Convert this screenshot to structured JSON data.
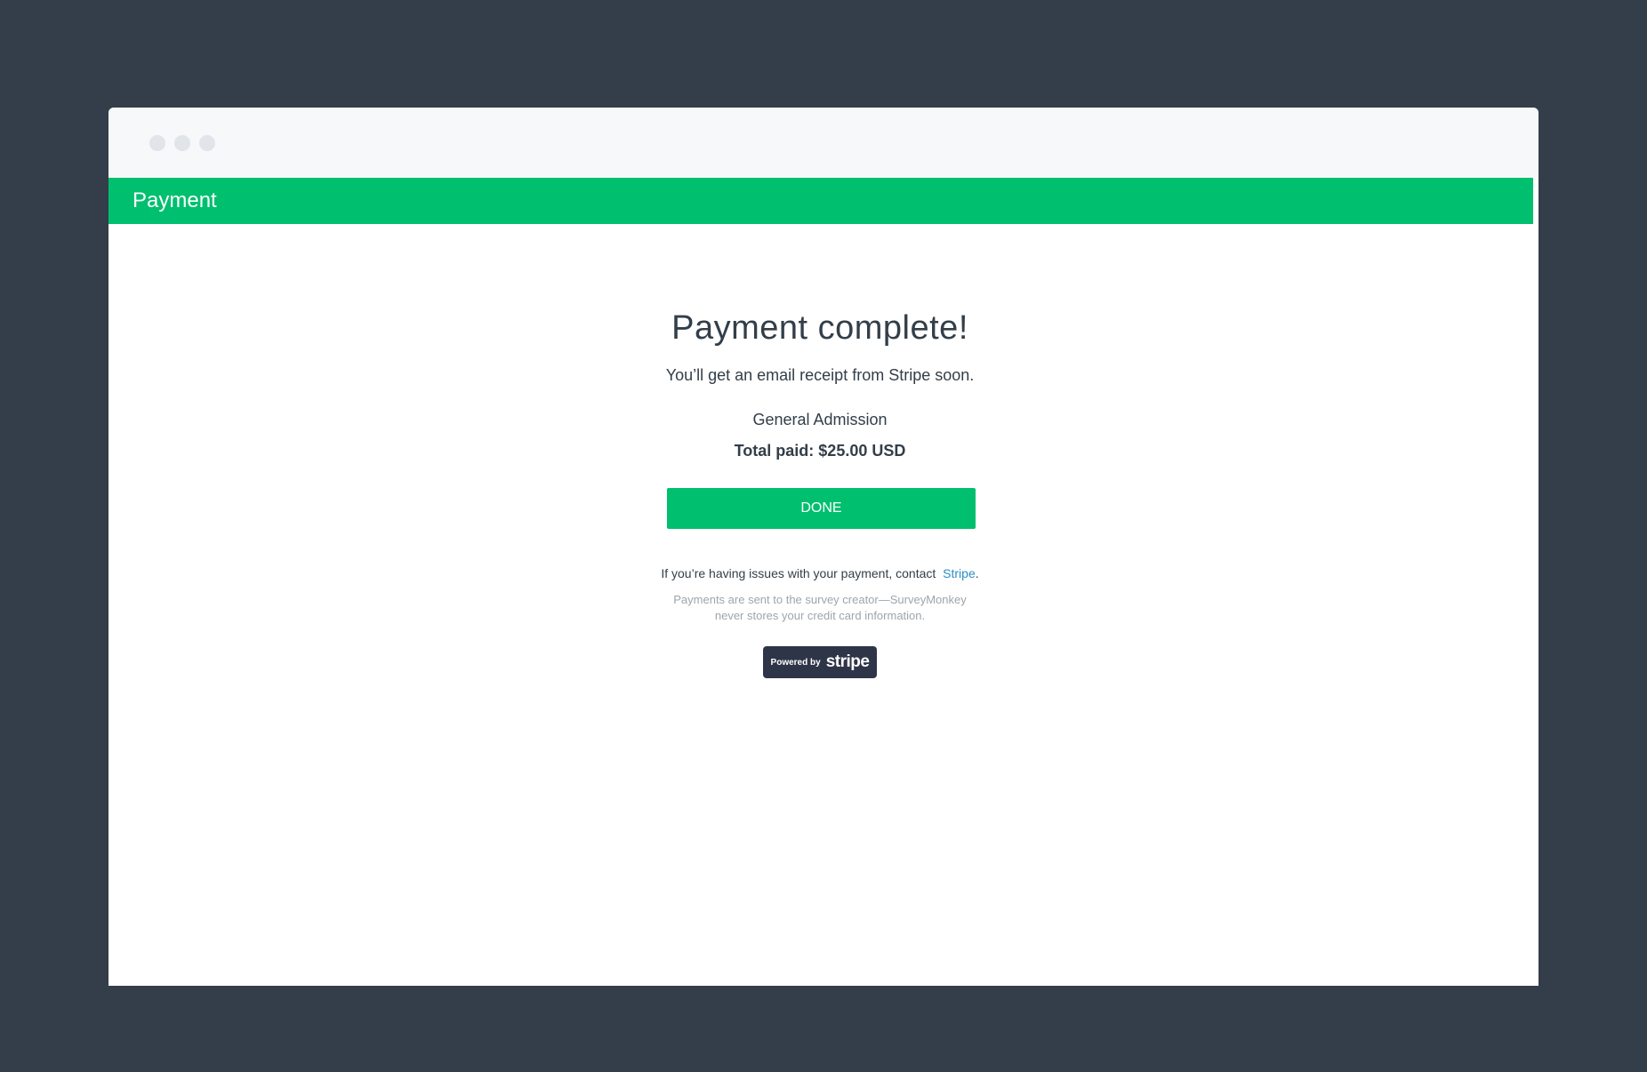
{
  "window": {
    "chrome_lights": [
      "traffic-light",
      "traffic-light",
      "traffic-light"
    ]
  },
  "header": {
    "title": "Payment",
    "color": "#00bf6f"
  },
  "main": {
    "title": "Payment complete!",
    "subtitle": "You’ll get an email receipt from Stripe soon.",
    "item_name": "General Admission",
    "total_paid": "Total paid: $25.00 USD",
    "done_label": "DONE",
    "contact_prefix": "If you’re having issues with your payment, contact",
    "contact_link": "Stripe",
    "contact_suffix": ".",
    "disclaimer_line1": "Payments are sent to the survey creator—SurveyMonkey",
    "disclaimer_line2": "never stores your credit card information."
  },
  "badge": {
    "powered_by": "Powered by",
    "wordmark": "stripe",
    "background": "#2f3548"
  }
}
